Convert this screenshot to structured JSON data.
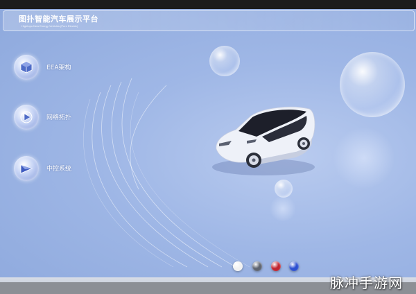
{
  "header": {
    "title": "图扑智能汽车展示平台",
    "subtitle": "Hightopo New Energy Vehicles (Pure Electric)"
  },
  "menu": [
    {
      "label": "EEA架构",
      "icon": "cube-icon"
    },
    {
      "label": "网络拓扑",
      "icon": "play-icon"
    },
    {
      "label": "中控系统",
      "icon": "triangle-icon"
    }
  ],
  "color_swatches": [
    {
      "name": "white",
      "color": "#f2f2f2"
    },
    {
      "name": "gray",
      "color": "#5e6470"
    },
    {
      "name": "red",
      "color": "#c0242f"
    },
    {
      "name": "blue",
      "color": "#2c4fd0"
    }
  ],
  "vehicle": {
    "body_color": "#eef1f8"
  },
  "colors": {
    "background": "#9fb7e6",
    "accent": "#ffffff"
  },
  "watermark": "脉冲手游网"
}
